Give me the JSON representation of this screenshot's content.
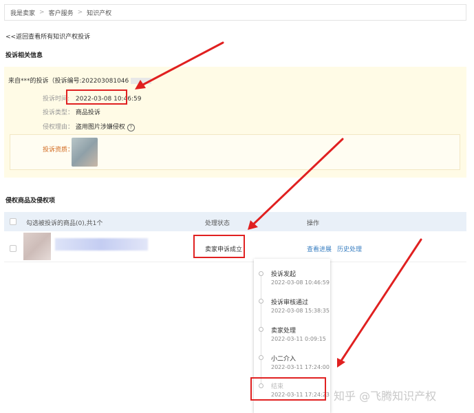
{
  "breadcrumb": {
    "items": [
      "我是卖家",
      "客户服务",
      "知识产权"
    ],
    "separator": ">"
  },
  "back_link": "<<返回查看所有知识产权投诉",
  "complaint_info": {
    "title": "投诉相关信息",
    "from_text": "来自***的投诉（投诉编号:202203081046",
    "time_label": "投诉时间:",
    "time_value": "2022-03-08 10:46:59",
    "type_label": "投诉类型：",
    "type_value": "商品投诉",
    "reason_label": "侵权理由：",
    "reason_value": "盗用图片涉嫌侵权",
    "reason_help": "?",
    "qualification_label": "投诉资质："
  },
  "products": {
    "title": "侵权商品及侵权项",
    "header_select": "勾选被投诉的商品(0),共1个",
    "header_status": "处理状态",
    "header_action": "操作",
    "row_status": "卖家申诉成立",
    "row_action_progress": "查看进展",
    "row_action_history": "历史处理"
  },
  "timeline": [
    {
      "title": "投诉发起",
      "time": "2022-03-08 10:46:59"
    },
    {
      "title": "投诉审核通过",
      "time": "2022-03-08 15:38:35"
    },
    {
      "title": "卖家处理",
      "time": "2022-03-11 0:09:15"
    },
    {
      "title": "小二介入",
      "time": "2022-03-11 17:24:00"
    },
    {
      "title": "结束",
      "time": "2022-03-11 17:24:23"
    }
  ],
  "watermark": "知乎 @飞腾知识产权",
  "colors": {
    "highlight": "#e02020",
    "link": "#3a7fc1",
    "info_bg": "#fffbe6",
    "table_header_bg": "#e9f0f8"
  }
}
